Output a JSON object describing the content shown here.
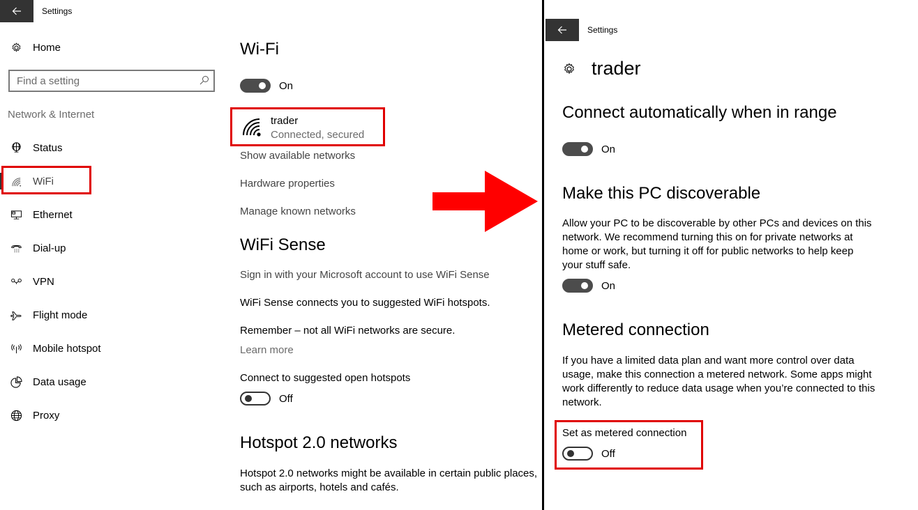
{
  "left_window": {
    "titlebar": {
      "back_icon": "arrow-left-icon",
      "title": "Settings"
    },
    "sidebar": {
      "home": {
        "icon": "gear-icon",
        "label": "Home"
      },
      "search": {
        "placeholder": "Find a setting",
        "value": "",
        "icon": "search-icon"
      },
      "category": "Network & Internet",
      "items": [
        {
          "icon": "globe-status-icon",
          "label": "Status",
          "selected": false
        },
        {
          "icon": "wifi-icon",
          "label": "WiFi",
          "selected": true
        },
        {
          "icon": "ethernet-icon",
          "label": "Ethernet",
          "selected": false
        },
        {
          "icon": "dialup-phone-icon",
          "label": "Dial-up",
          "selected": false
        },
        {
          "icon": "vpn-icon",
          "label": "VPN",
          "selected": false
        },
        {
          "icon": "airplane-icon",
          "label": "Flight mode",
          "selected": false
        },
        {
          "icon": "mobile-hotspot-icon",
          "label": "Mobile hotspot",
          "selected": false
        },
        {
          "icon": "data-usage-icon",
          "label": "Data usage",
          "selected": false
        },
        {
          "icon": "proxy-globe-icon",
          "label": "Proxy",
          "selected": false
        }
      ]
    },
    "main": {
      "title": "Wi-Fi",
      "wifi_toggle": {
        "state": "On",
        "on": true
      },
      "network": {
        "name": "trader",
        "status": "Connected, secured",
        "icon": "wifi-signal-icon"
      },
      "links": [
        "Show available networks",
        "Hardware properties",
        "Manage known networks"
      ],
      "wifi_sense": {
        "title": "WiFi Sense",
        "sign_in_link": "Sign in with your Microsoft account to use WiFi Sense",
        "description": "WiFi Sense connects you to suggested WiFi hotspots.",
        "remember": "Remember – not all WiFi networks are secure.",
        "learn_more": "Learn more",
        "open_hotspots_label": "Connect to suggested open hotspots",
        "open_hotspots_toggle": {
          "state": "Off",
          "on": false
        }
      },
      "hotspot20": {
        "title": "Hotspot 2.0 networks",
        "description": "Hotspot 2.0 networks might be available in certain public places, such as airports, hotels and cafés."
      }
    }
  },
  "right_window": {
    "titlebar": {
      "back_icon": "arrow-left-icon",
      "title": "Settings"
    },
    "header": {
      "icon": "gear-icon",
      "title": "trader"
    },
    "connect_auto": {
      "title": "Connect automatically when in range",
      "toggle": {
        "state": "On",
        "on": true
      }
    },
    "discoverable": {
      "title": "Make this PC discoverable",
      "description": "Allow your PC to be discoverable by other PCs and devices on this network. We recommend turning this on for private networks at home or work, but turning it off for public networks to help keep your stuff safe.",
      "toggle": {
        "state": "On",
        "on": true
      }
    },
    "metered": {
      "title": "Metered connection",
      "description": "If you have a limited data plan and want more control over data usage, make this connection a metered network. Some apps might work differently to reduce data usage when you’re connected to this network.",
      "setting_label": "Set as metered connection",
      "toggle": {
        "state": "Off",
        "on": false
      }
    }
  },
  "annotations": {
    "highlight_color": "#e00000",
    "arrow_color": "#ff0000",
    "arrow_direction": "right"
  }
}
